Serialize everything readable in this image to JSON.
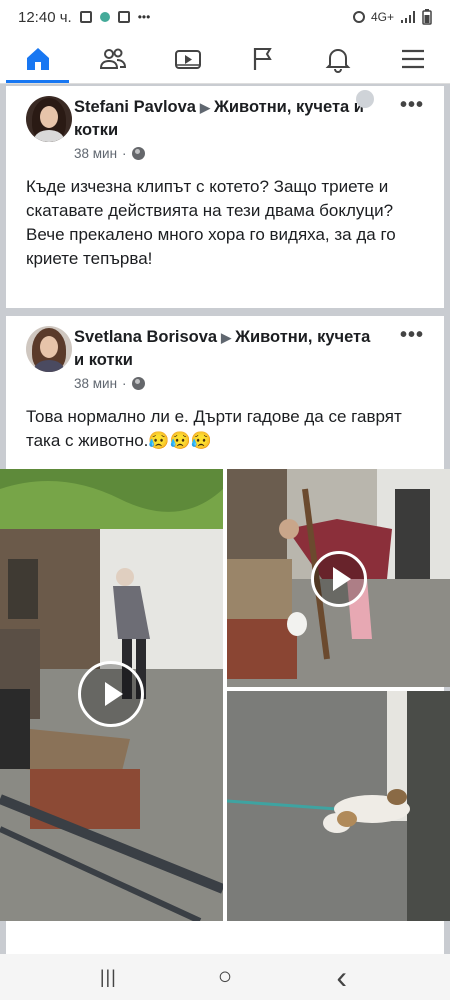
{
  "status_bar": {
    "time": "12:40 ч.",
    "more": "•••",
    "network": "4G+"
  },
  "nav": {
    "items": [
      {
        "name": "home-icon",
        "active": true
      },
      {
        "name": "friends-icon",
        "active": false
      },
      {
        "name": "watch-icon",
        "active": false
      },
      {
        "name": "pages-flag-icon",
        "active": false
      },
      {
        "name": "notifications-bell-icon",
        "active": false
      },
      {
        "name": "menu-icon",
        "active": false
      }
    ],
    "accent": "#1877f2"
  },
  "posts": [
    {
      "author": "Stefani Pavlova",
      "group": "Животни, кучета и котки",
      "time": "38 мин",
      "more": "•••",
      "text": "Къде изчезна клипът с котето? Защо триете и скатавате действията на тези двама боклуци?\nВече прекалено много хора го видяха, за да го криете тепърва!"
    },
    {
      "author": "Svetlana Borisova",
      "group": "Животни, кучета и котки",
      "time": "38 мин",
      "more": "•••",
      "text": "Това нормално ли е. Дърти гадове да се гаврят така с животно.😥😥😥",
      "media": [
        "video-thumbnail",
        "video-thumbnail",
        "photo-thumbnail"
      ]
    }
  ],
  "system_nav": {
    "recent": "|||",
    "home": "○",
    "back": "‹"
  }
}
